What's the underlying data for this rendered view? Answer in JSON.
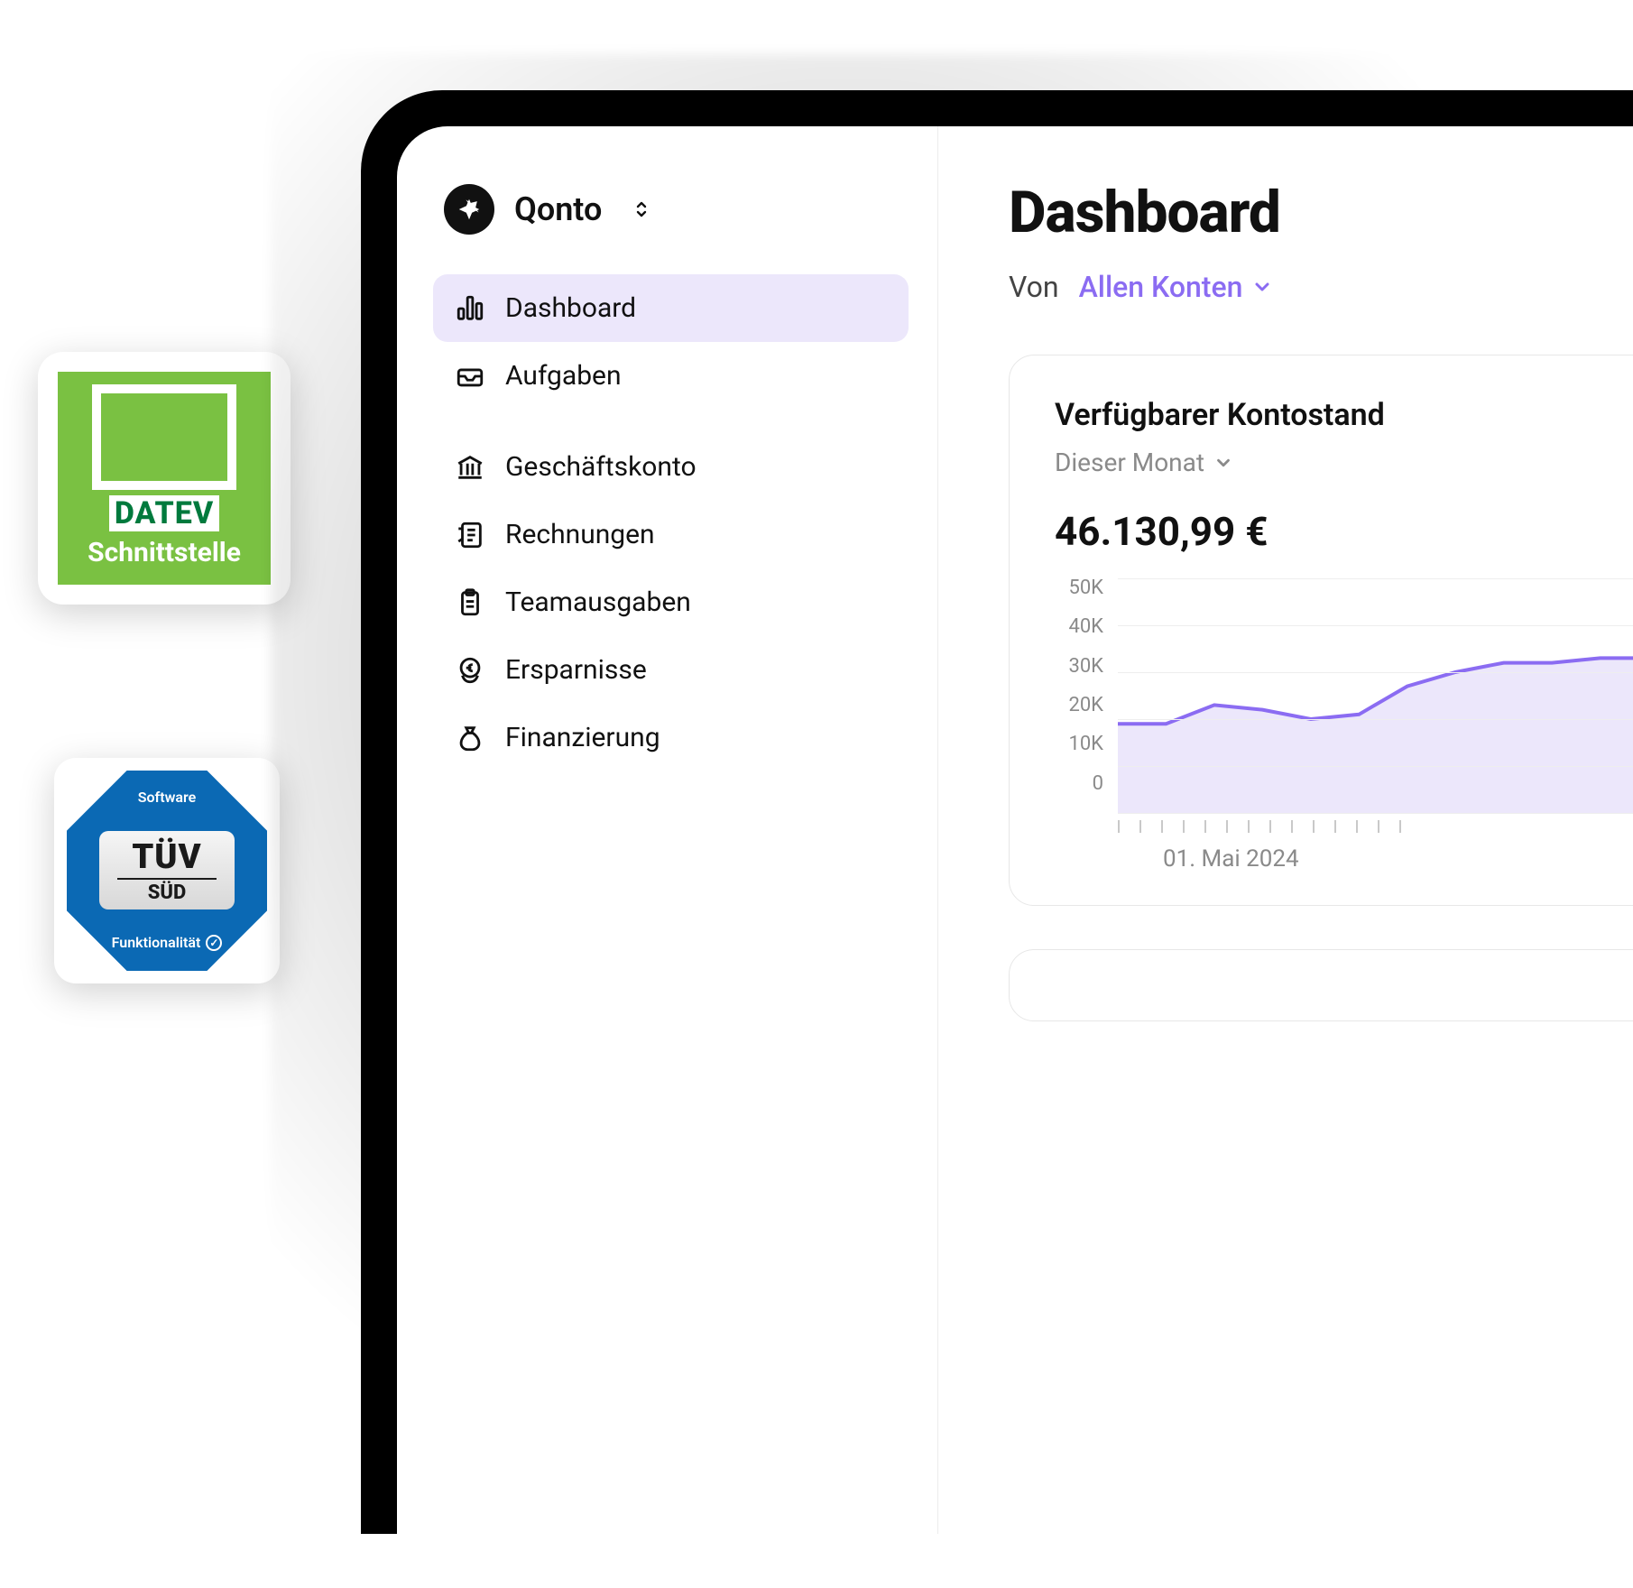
{
  "badges": {
    "datev": {
      "wordmark": "DATEV",
      "subtitle": "Schnittstelle"
    },
    "tuv": {
      "top": "Software",
      "main": "TÜV",
      "sud": "SÜD",
      "bottom": "Funktionalität"
    }
  },
  "brand": {
    "name": "Qonto"
  },
  "sidebar": {
    "items": [
      {
        "label": "Dashboard",
        "icon": "bar-chart-icon",
        "active": true
      },
      {
        "label": "Aufgaben",
        "icon": "inbox-icon",
        "active": false
      },
      {
        "label": "Geschäftskonto",
        "icon": "bank-icon",
        "active": false
      },
      {
        "label": "Rechnungen",
        "icon": "receipt-icon",
        "active": false
      },
      {
        "label": "Teamausgaben",
        "icon": "clipboard-icon",
        "active": false
      },
      {
        "label": "Ersparnisse",
        "icon": "euro-circle-icon",
        "active": false
      },
      {
        "label": "Finanzierung",
        "icon": "money-bag-icon",
        "active": false
      }
    ]
  },
  "main": {
    "title": "Dashboard",
    "filter_label": "Von",
    "filter_value": "Allen Konten"
  },
  "balance_card": {
    "title": "Verfügbarer Kontostand",
    "period": "Dieser Monat",
    "amount": "46.130,99 €",
    "x_label": "01. Mai 2024"
  },
  "chart_data": {
    "type": "area",
    "ylabel": "",
    "ylim": [
      0,
      50
    ],
    "y_ticks": [
      "50K",
      "40K",
      "30K",
      "20K",
      "10K",
      "0"
    ],
    "x": [
      0,
      1,
      2,
      3,
      4,
      5,
      6,
      7,
      8,
      9,
      10,
      11
    ],
    "values": [
      19,
      19,
      23,
      22,
      20,
      21,
      27,
      30,
      32,
      32,
      33,
      33
    ],
    "x_tick_label_visible": "01. Mai 2024",
    "series_color": "#8b6cf2",
    "fill_color": "#ece7fb"
  }
}
